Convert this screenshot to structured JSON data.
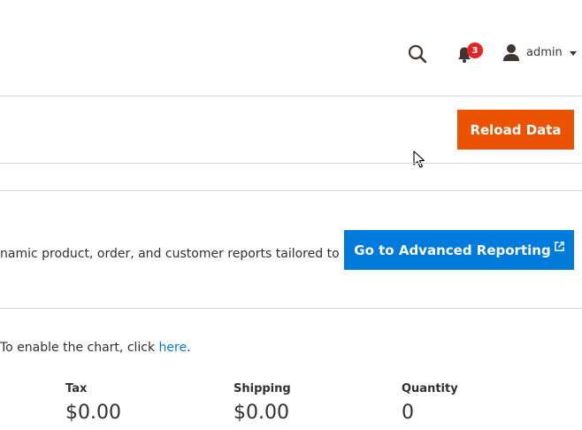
{
  "header": {
    "notifications_count": "3",
    "user_name": "admin"
  },
  "toolbar": {
    "reload_label": "Reload Data"
  },
  "advanced_reporting": {
    "description": "namic product, order, and customer reports tailored to",
    "button_label": "Go to Advanced Reporting"
  },
  "chart": {
    "message_prefix": "To enable the chart, click ",
    "link_text": "here",
    "message_suffix": "."
  },
  "totals": [
    {
      "label": "Tax",
      "value": "$0.00"
    },
    {
      "label": "Shipping",
      "value": "$0.00"
    },
    {
      "label": "Quantity",
      "value": "0"
    }
  ],
  "colors": {
    "reload_button": "#eb5202",
    "advanced_button": "#007bdb",
    "badge": "#e22626",
    "link": "#007bdb"
  },
  "icons": [
    "search-icon",
    "bell-icon",
    "user-icon",
    "external-link-icon",
    "mouse-cursor-icon"
  ]
}
